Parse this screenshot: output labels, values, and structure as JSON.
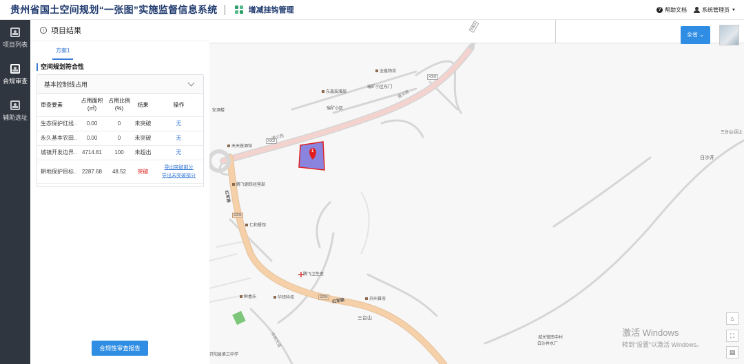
{
  "header": {
    "app_title": "贵州省国土空间规划“一张图”实施监督信息系统",
    "module_title": "增减挂钩管理",
    "help_label": "帮助文档",
    "user_label": "系统管理员"
  },
  "leftnav": {
    "items": [
      {
        "label": "项目列表",
        "icon": "project-list-icon"
      },
      {
        "label": "合规审查",
        "icon": "compliance-review-icon"
      },
      {
        "label": "辅助选址",
        "icon": "site-selection-icon"
      }
    ]
  },
  "panel": {
    "title": "项目结果",
    "tab": "方案1",
    "section_title": "空间规划符合性",
    "card_title": "基本控制线占用",
    "table": {
      "headers": [
        "审查要素",
        "占用面积(㎡)",
        "占用比例(%)",
        "结果",
        "操作"
      ],
      "rows": [
        {
          "element": "生态保护红线...",
          "area": "0.00",
          "ratio": "0",
          "result": "未突破",
          "op": "无"
        },
        {
          "element": "永久基本农田...",
          "area": "0.00",
          "ratio": "0",
          "result": "未突破",
          "op": "无"
        },
        {
          "element": "城镇开发边界...",
          "area": "4714.81",
          "ratio": "100",
          "result": "未超出",
          "op": "无"
        },
        {
          "element": "耕地保护目标...",
          "area": "2287.68",
          "ratio": "48.52",
          "result": "突破",
          "op1": "导出突破部分",
          "op2": "导出未突破部分"
        }
      ]
    },
    "report_button": "合规性审查报告"
  },
  "map": {
    "all_button": "全省",
    "marker_number": "1",
    "labels": {
      "l1": "全鑫物流",
      "l2": "瑞矿小区东门",
      "l3": "东鑫装潢部",
      "l4": "瑞矿小区",
      "l5": "天天爸酒馆",
      "l6": "安酒楼",
      "l7": "腾飞钢铁经营部",
      "l8": "仁和餐馆",
      "l9": "腾飞卫生室",
      "l10": "开州首府",
      "l11": "华钜科技",
      "l12": "鲜香乐",
      "l13": "三台山",
      "l14": "白沙井",
      "l15": "三台山·因上",
      "l16": "城关镇南中村",
      "l17": "白沙井水厂",
      "l18": "开阳县第三中学",
      "road1": "遵义路",
      "road2": "红军路",
      "road3": "红军路",
      "road4": "遵义路",
      "road5": "开州大道",
      "badge1": "X002",
      "badge2": "X002",
      "badge3": "X003",
      "badge4": "S205",
      "badge5": "S205"
    },
    "watermark_line1": "激活 Windows",
    "watermark_line2": "转到“设置”以激活 Windows。"
  }
}
